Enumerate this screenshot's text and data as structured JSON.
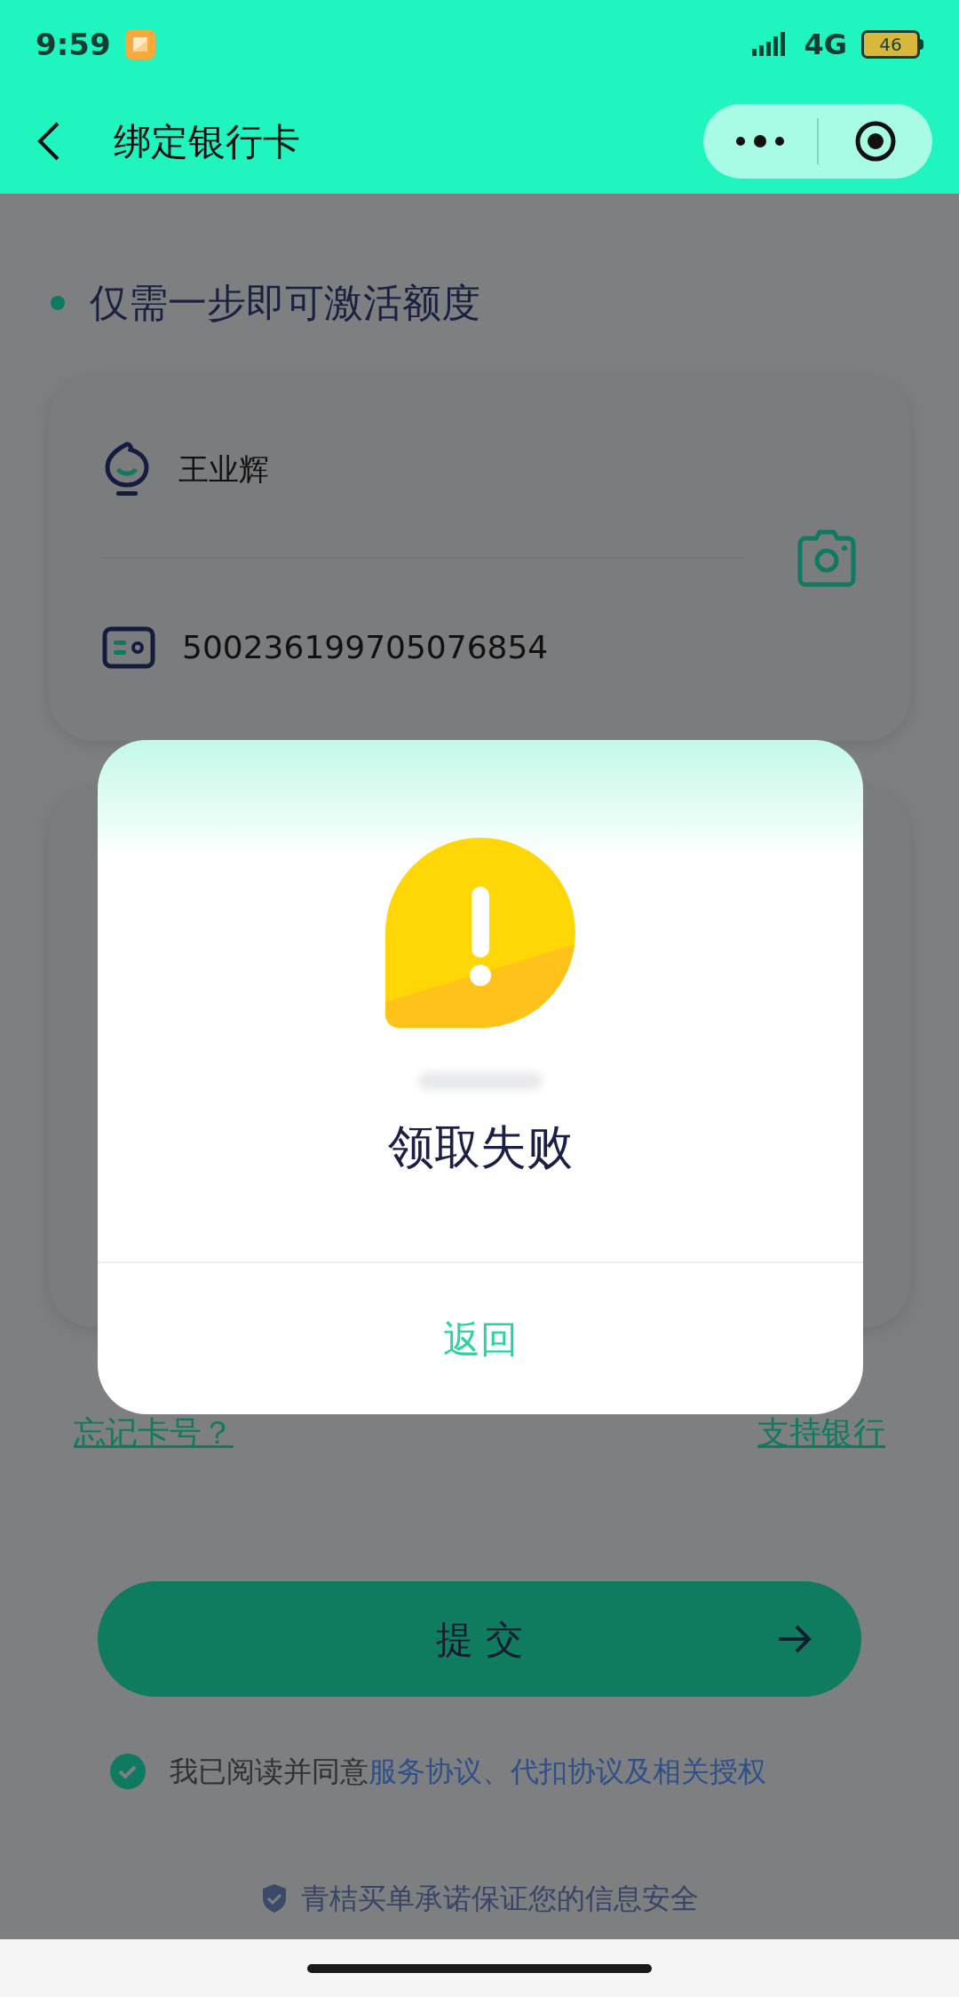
{
  "status_bar": {
    "time": "9:59",
    "network": "4G",
    "battery": "46"
  },
  "header": {
    "title": "绑定银行卡"
  },
  "heading": "仅需一步即可激活额度",
  "identity_card": {
    "name": "王业辉",
    "id_number": "500236199705076854"
  },
  "links": [
    "忘记卡号？",
    "支持银行"
  ],
  "submit_button": "提 交",
  "agreement": {
    "checked": true,
    "text": "我已阅读并同意",
    "link": "服务协议、代扣协议及相关授权"
  },
  "footer_note": "青桔买单承诺保证您的信息安全",
  "dialog": {
    "title": "领取失败",
    "button": "返回"
  }
}
